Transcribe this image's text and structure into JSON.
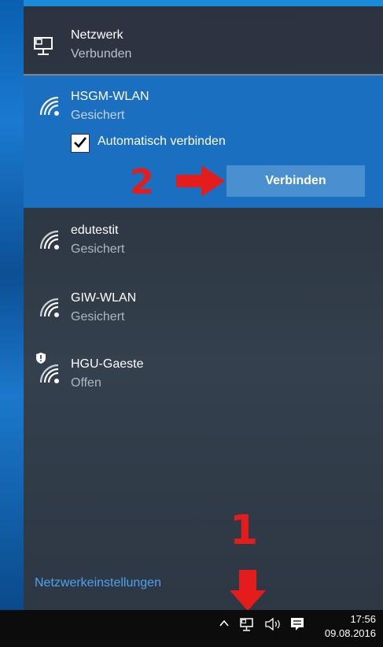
{
  "header": {
    "title": "Netzwerk",
    "status": "Verbunden"
  },
  "networks": [
    {
      "ssid": "HSGM-WLAN",
      "security": "Gesichert",
      "auto_connect_label": "Automatisch verbinden",
      "auto_connect_checked": true,
      "connect_label": "Verbinden"
    },
    {
      "ssid": "edutestit",
      "security": "Gesichert"
    },
    {
      "ssid": "GIW-WLAN",
      "security": "Gesichert"
    },
    {
      "ssid": "HGU-Gaeste",
      "security": "Offen"
    }
  ],
  "annotations": {
    "step1": "1",
    "step2": "2"
  },
  "settings_link": "Netzwerkeinstellungen",
  "taskbar": {
    "time": "17:56",
    "date": "09.08.2016"
  },
  "colors": {
    "accent": "#1b6fc0",
    "button": "#4a90d0",
    "annotation": "#e41c1c",
    "link": "#4aa3ef"
  }
}
